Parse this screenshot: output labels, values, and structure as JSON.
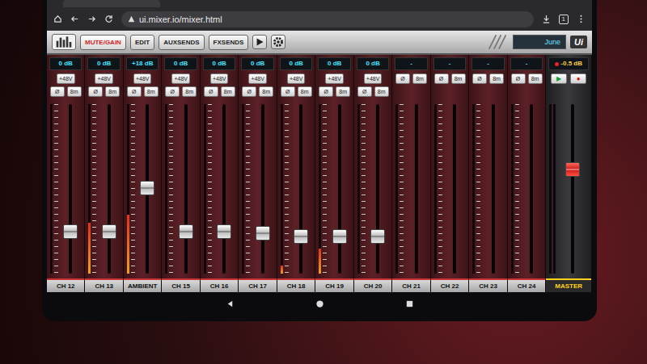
{
  "browser": {
    "address": "ui.mixer.io/mixer.html",
    "tabs_count": "1"
  },
  "toolbar": {
    "buttons": [
      {
        "label": "MUTE/GAIN",
        "selected": true
      },
      {
        "label": "EDIT",
        "selected": false
      },
      {
        "label": "AUXSENDS",
        "selected": false
      },
      {
        "label": "FXSENDS",
        "selected": false
      }
    ],
    "show": "June",
    "logo": "Ui"
  },
  "channels": [
    {
      "name": "CH 12",
      "gain": "0 dB",
      "buttons": [
        "+48V",
        "Ø",
        "8m"
      ],
      "level": 0.22,
      "meter": 0
    },
    {
      "name": "CH 13",
      "gain": "0 dB",
      "buttons": [
        "+48V",
        "Ø",
        "8m"
      ],
      "level": 0.22,
      "meter": 0.3
    },
    {
      "name": "AMBIENT",
      "gain": "+18 dB",
      "buttons": [
        "+48V",
        "Ø",
        "8m"
      ],
      "level": 0.5,
      "meter": 0.35
    },
    {
      "name": "CH 15",
      "gain": "0 dB",
      "buttons": [
        "+48V",
        "Ø",
        "8m"
      ],
      "level": 0.22,
      "meter": 0
    },
    {
      "name": "CH 16",
      "gain": "0 dB",
      "buttons": [
        "+48V",
        "Ø",
        "8m"
      ],
      "level": 0.22,
      "meter": 0
    },
    {
      "name": "CH 17",
      "gain": "0 dB",
      "buttons": [
        "+48V",
        "Ø",
        "8m"
      ],
      "level": 0.21,
      "meter": 0
    },
    {
      "name": "CH 18",
      "gain": "0 dB",
      "buttons": [
        "+48V",
        "Ø",
        "8m"
      ],
      "level": 0.19,
      "meter": 0.05
    },
    {
      "name": "CH 19",
      "gain": "0 dB",
      "buttons": [
        "+48V",
        "Ø",
        "8m"
      ],
      "level": 0.19,
      "meter": 0.15
    },
    {
      "name": "CH 20",
      "gain": "0 dB",
      "buttons": [
        "+48V",
        "Ø",
        "8m"
      ],
      "level": 0.19,
      "meter": 0
    },
    {
      "name": "CH 21",
      "gain": "-",
      "buttons": [
        "Ø",
        "8m"
      ],
      "level": 0,
      "meter": 0
    },
    {
      "name": "CH 22",
      "gain": "-",
      "buttons": [
        "Ø",
        "8m"
      ],
      "level": 0,
      "meter": 0
    },
    {
      "name": "CH 23",
      "gain": "-",
      "buttons": [
        "Ø",
        "8m"
      ],
      "level": 0,
      "meter": 0
    },
    {
      "name": "CH 24",
      "gain": "-",
      "buttons": [
        "Ø",
        "8m"
      ],
      "level": 0,
      "meter": 0
    }
  ],
  "master": {
    "name": "MASTER",
    "gain": "-0.5 dB",
    "buttons": [
      "▶",
      "●"
    ],
    "level": 0.62,
    "meter_l": 0,
    "meter_r": 0
  }
}
